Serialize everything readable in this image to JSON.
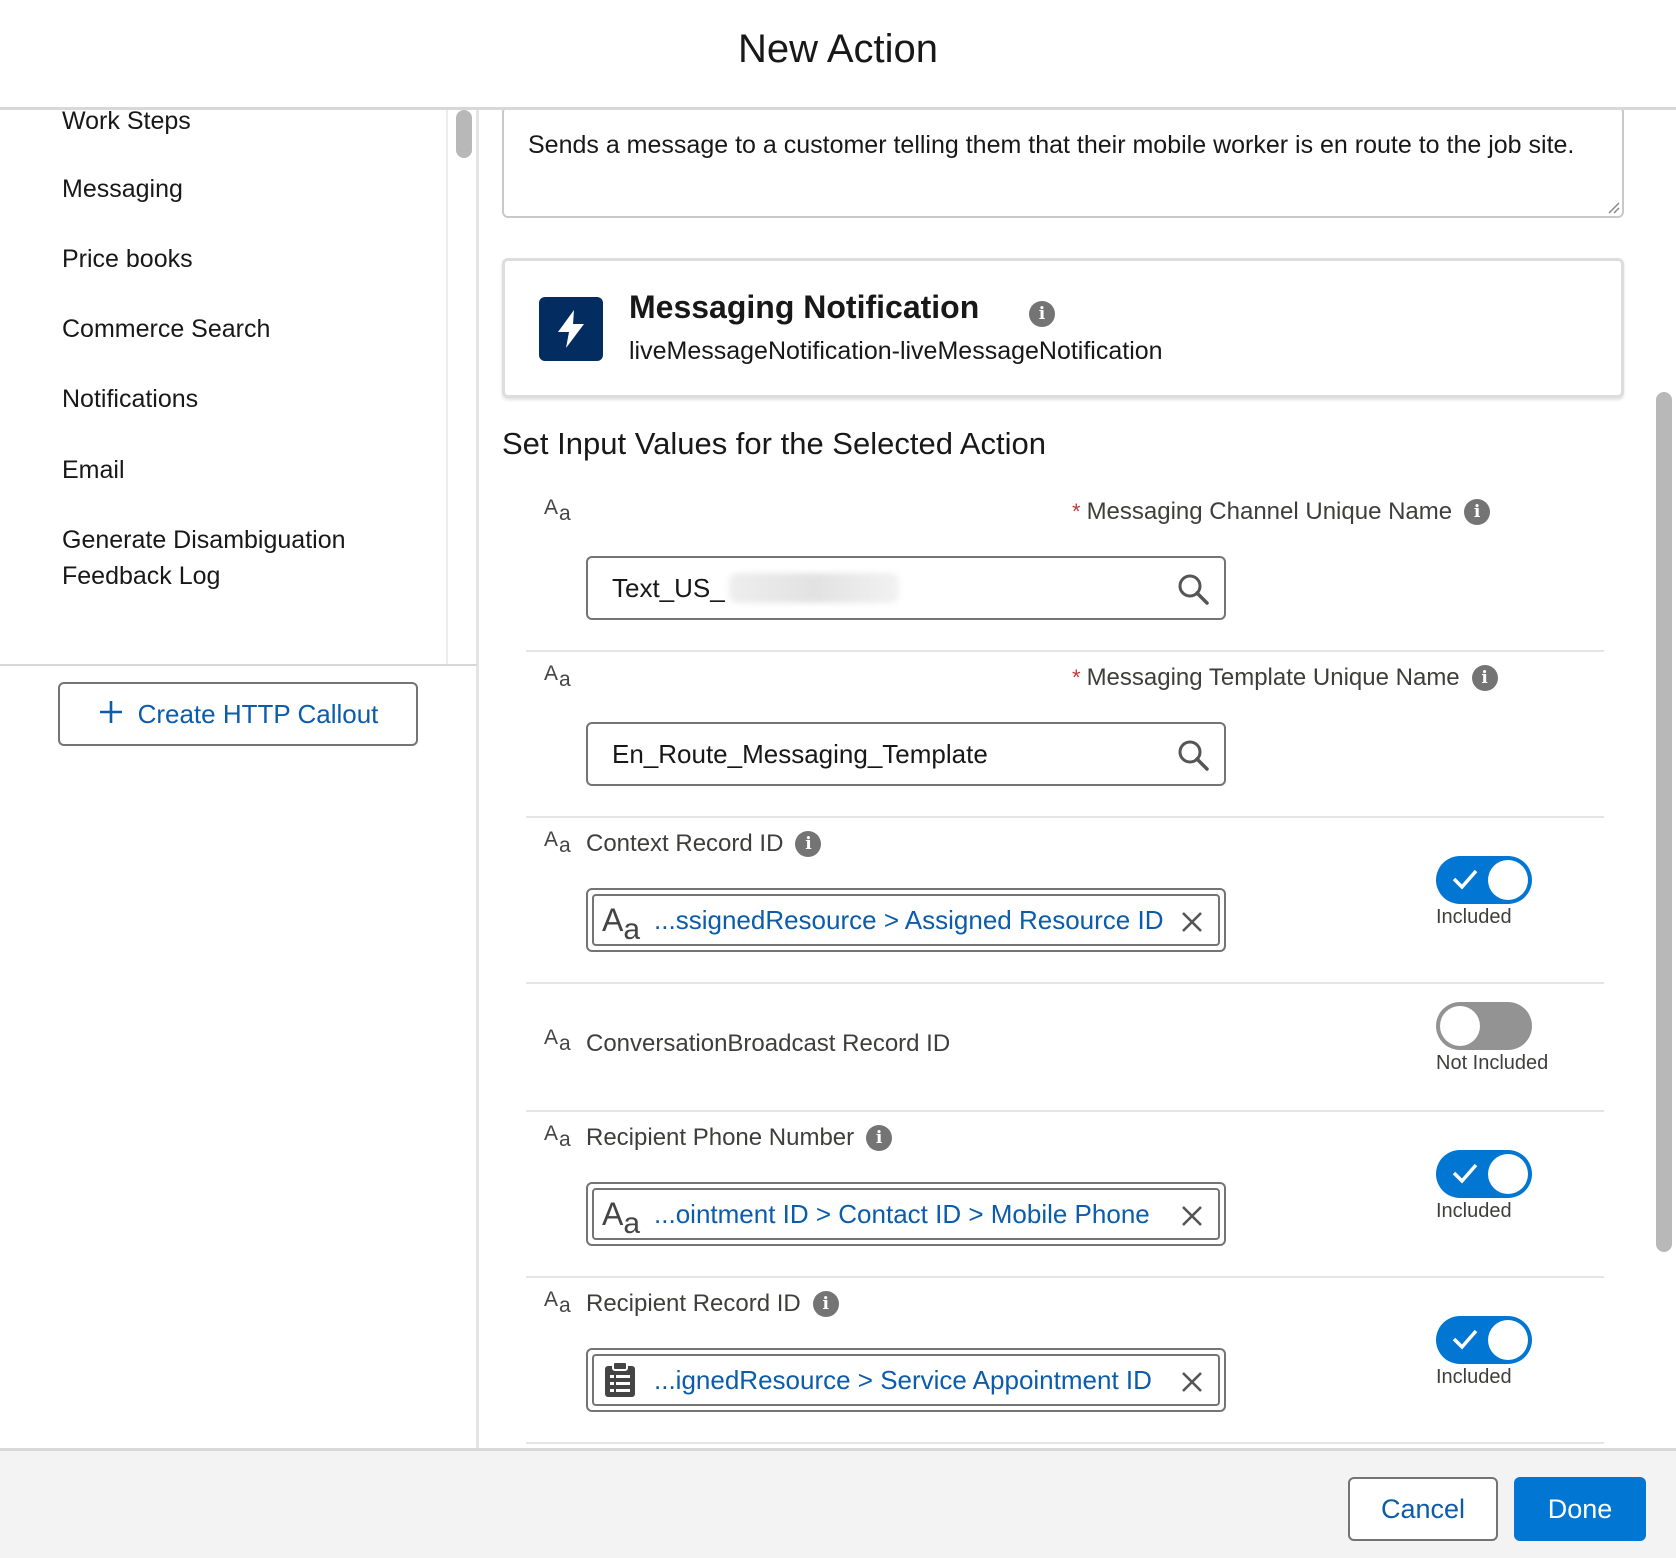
{
  "modal": {
    "title": "New Action"
  },
  "sidebar": {
    "items": [
      {
        "label": "Work Steps"
      },
      {
        "label": "Messaging"
      },
      {
        "label": "Price books"
      },
      {
        "label": "Commerce Search"
      },
      {
        "label": "Notifications"
      },
      {
        "label": "Email"
      },
      {
        "label": "Generate Disambiguation"
      },
      {
        "label": "Feedback Log"
      }
    ],
    "create_button": "Create HTTP Callout"
  },
  "description": {
    "value": "Sends a message to a customer telling them that their mobile worker is en route to the job site."
  },
  "action_card": {
    "icon": "lightning-bolt-icon",
    "title": "Messaging Notification",
    "api_name": "liveMessageNotification-liveMessageNotification"
  },
  "section": {
    "title": "Set Input Values for the Selected Action"
  },
  "fields": {
    "channel": {
      "label": "Messaging Channel Unique Name",
      "required_mark": "*",
      "value": "Text_US_"
    },
    "template": {
      "label": "Messaging Template Unique Name",
      "required_mark": "*",
      "value": "En_Route_Messaging_Template"
    },
    "context": {
      "label": "Context Record ID",
      "value": "...ssignedResource > Assigned Resource ID",
      "toggle_label": "Included"
    },
    "broadcast": {
      "label": "ConversationBroadcast Record ID",
      "toggle_label": "Not Included"
    },
    "phone": {
      "label": "Recipient Phone Number",
      "value": "...ointment ID > Contact ID > Mobile Phone",
      "toggle_label": "Included"
    },
    "recipient": {
      "label": "Recipient Record ID",
      "value": "...ignedResource > Service Appointment ID",
      "toggle_label": "Included"
    }
  },
  "text_type_icon": {
    "big": "A",
    "small": "a"
  },
  "info_glyph": "i",
  "footer": {
    "cancel": "Cancel",
    "done": "Done"
  },
  "colors": {
    "brand": "#0176d3",
    "link": "#0b5cab",
    "action_icon_bg": "#032d60",
    "required": "#c23934"
  }
}
